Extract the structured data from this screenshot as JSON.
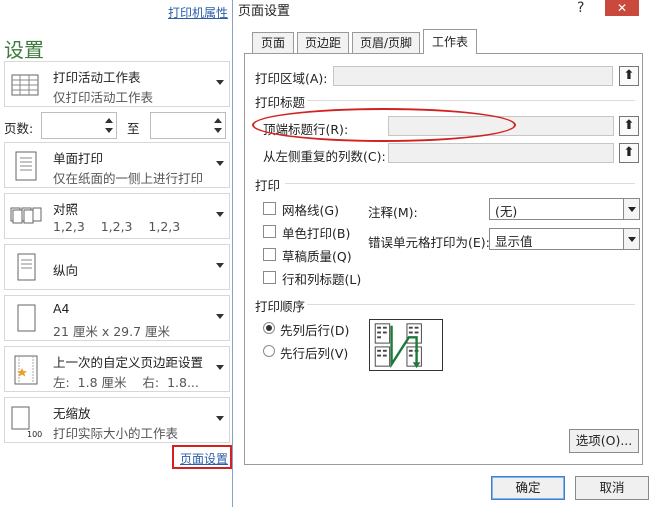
{
  "left_panel": {
    "printer_properties_link": "打印机属性",
    "title": "设置",
    "print_what": {
      "line1": "打印活动工作表",
      "line2": "仅打印活动工作表",
      "icon": "sheets-icon"
    },
    "pages": {
      "label": "页数:",
      "to_label": "至",
      "from_value": "",
      "to_value": ""
    },
    "sides": {
      "line1": "单面打印",
      "line2": "仅在纸面的一侧上进行打印",
      "icon": "single-sided-icon"
    },
    "collate": {
      "line1": "对照",
      "line2": "1,2,3    1,2,3    1,2,3",
      "icon": "collate-icon"
    },
    "orientation": {
      "line1": "纵向",
      "icon": "portrait-icon"
    },
    "paper_size": {
      "line1": "A4",
      "line2": "21 厘米 x 29.7 厘米",
      "icon": "paper-icon"
    },
    "margins": {
      "line1": "上一次的自定义页边距设置",
      "line2": "左:  1.8 厘米    右:  1.8...",
      "icon": "margins-icon"
    },
    "scaling": {
      "line1": "无缩放",
      "line2": "打印实际大小的工作表",
      "icon": "scale-100-icon",
      "icon_text": "100"
    },
    "page_setup_link": "页面设置"
  },
  "dialog": {
    "title": "页面设置",
    "help_glyph": "?",
    "close_glyph": "✕",
    "tabs": [
      {
        "label": "页面",
        "active": false
      },
      {
        "label": "页边距",
        "active": false
      },
      {
        "label": "页眉/页脚",
        "active": false
      },
      {
        "label": "工作表",
        "active": true
      }
    ],
    "print_area": {
      "label": "打印区域(A):",
      "value": ""
    },
    "print_titles": {
      "group_label": "打印标题",
      "top_rows_label": "顶端标题行(R):",
      "top_rows_value": "",
      "left_cols_label": "从左侧重复的列数(C):",
      "left_cols_value": ""
    },
    "print": {
      "group_label": "打印",
      "checkboxes": [
        {
          "label": "网格线(G)",
          "checked": false
        },
        {
          "label": "单色打印(B)",
          "checked": false
        },
        {
          "label": "草稿质量(Q)",
          "checked": false
        },
        {
          "label": "行和列标题(L)",
          "checked": false
        }
      ],
      "comments_label": "注释(M):",
      "comments_value": "(无)",
      "errors_label": "错误单元格打印为(E):",
      "errors_value": "显示值"
    },
    "page_order": {
      "group_label": "打印顺序",
      "options": [
        {
          "label": "先列后行(D)",
          "selected": true
        },
        {
          "label": "先行后列(V)",
          "selected": false
        }
      ]
    },
    "options_button": "选项(O)...",
    "ok_button": "确定",
    "cancel_button": "取消",
    "collapse_glyph": "⬆"
  },
  "colors": {
    "accent_red": "#d42020",
    "link_blue": "#2a5ea8",
    "title_green": "#3e7c3e"
  }
}
